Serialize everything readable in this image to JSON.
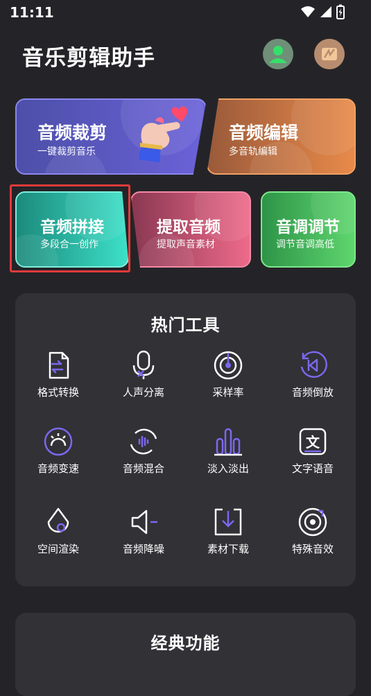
{
  "status_bar": {
    "time": "11:11"
  },
  "header": {
    "title": "音乐剪辑助手"
  },
  "feature_cards": [
    {
      "title": "音频裁剪",
      "subtitle": "一键裁剪音乐"
    },
    {
      "title": "音频编辑",
      "subtitle": "多音轨编辑"
    },
    {
      "title": "音频拼接",
      "subtitle": "多段合一创作"
    },
    {
      "title": "提取音频",
      "subtitle": "提取声音素材"
    },
    {
      "title": "音调调节",
      "subtitle": "调节音调高低"
    }
  ],
  "hot_tools": {
    "title": "热门工具",
    "items": [
      {
        "label": "格式转换",
        "icon": "format-convert-icon"
      },
      {
        "label": "人声分离",
        "icon": "microphone-icon"
      },
      {
        "label": "采样率",
        "icon": "sample-rate-icon"
      },
      {
        "label": "音频倒放",
        "icon": "rewind-icon"
      },
      {
        "label": "音频变速",
        "icon": "speed-icon"
      },
      {
        "label": "音频混合",
        "icon": "mix-icon"
      },
      {
        "label": "淡入淡出",
        "icon": "fade-icon"
      },
      {
        "label": "文字语音",
        "icon": "text-speech-icon"
      },
      {
        "label": "空间渲染",
        "icon": "spatial-icon"
      },
      {
        "label": "音频降噪",
        "icon": "denoise-icon"
      },
      {
        "label": "素材下载",
        "icon": "download-icon"
      },
      {
        "label": "特殊音效",
        "icon": "special-effect-icon"
      }
    ]
  },
  "classic": {
    "title": "经典功能"
  },
  "colors": {
    "background": "#242428",
    "panel": "#313136",
    "accent": "#7b68ee",
    "highlight": "#e23a3a"
  }
}
